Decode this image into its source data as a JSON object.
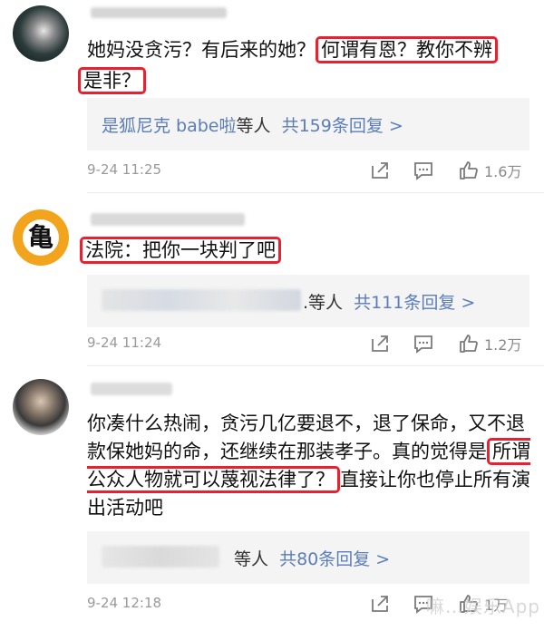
{
  "comments": [
    {
      "text_a": "她妈没贪污？有后来的她？",
      "highlight_1": "何谓有恩？教你不辨",
      "highlight_2": "是非？",
      "reply_user": "是狐尼克 babe啦",
      "reply_suffix": "等人",
      "reply_count": "共159条回复 >",
      "time": "9-24 11:25",
      "likes": "1.6万"
    },
    {
      "avatar_glyph": "亀",
      "highlight": "法院：把你一块判了吧",
      "reply_suffix": ".等人",
      "reply_count": "共111条回复 >",
      "time": "9-24 11:24",
      "likes": "1.2万"
    },
    {
      "text_a": "你凑什么热闹，贪污几亿要退不，退了保命，又不退款保她妈的命，还继续在那装孝子。真的觉得是",
      "highlight": "所谓公众人物就可以蔑视法律了？",
      "text_b": "直接让你也停止所有演出活动吧",
      "reply_suffix": "等人",
      "reply_count": "共80条回复 >",
      "time": "9-24 12:18",
      "likes": "1万"
    }
  ],
  "watermark": "嘛…娱乐App",
  "colors": {
    "highlight_border": "#e8202f",
    "reply_link": "#5b7db8",
    "reply_bg": "#f4f4f4"
  },
  "icons": [
    "share-icon",
    "comment-icon",
    "like-icon"
  ]
}
